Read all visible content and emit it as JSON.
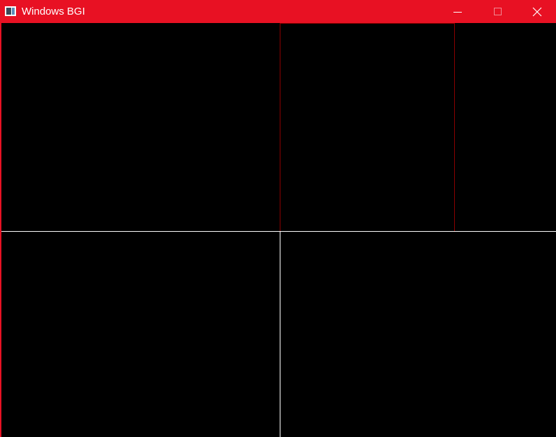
{
  "window": {
    "title": "Windows BGI",
    "app_icon": "bgi-app-icon",
    "controls": {
      "minimize_icon": "minimize-icon",
      "maximize_icon": "maximize-icon",
      "close_icon": "close-icon"
    },
    "colors": {
      "titlebar": "#e81123",
      "title_text": "#ffffff",
      "canvas_background": "#000000"
    }
  },
  "drawing": {
    "colors": {
      "white_lines": "#ffffff",
      "red_rectangle": "#8b0000"
    }
  }
}
